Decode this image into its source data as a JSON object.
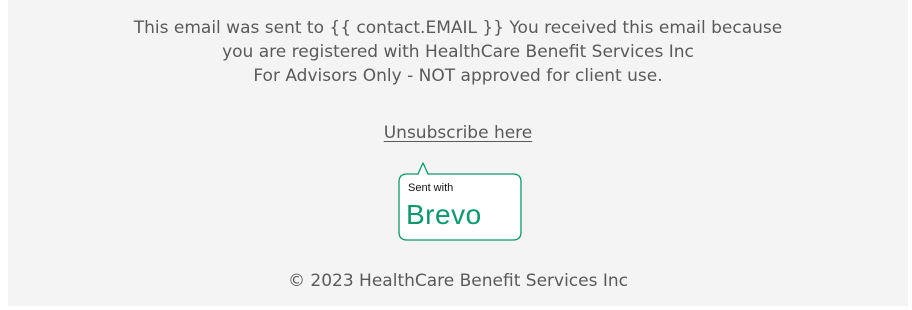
{
  "footer": {
    "info_lines": [
      "This email was sent to {{ contact.EMAIL }}  You received this email because",
      "you are registered with HealthCare Benefit Services Inc",
      "For Advisors Only - NOT approved for client use."
    ],
    "unsubscribe_label": "Unsubscribe here",
    "badge": {
      "sent_with": "Sent with",
      "brand": "Brevo",
      "brand_color": "#0b996e"
    },
    "copyright": "© 2023 HealthCare Benefit Services Inc"
  }
}
